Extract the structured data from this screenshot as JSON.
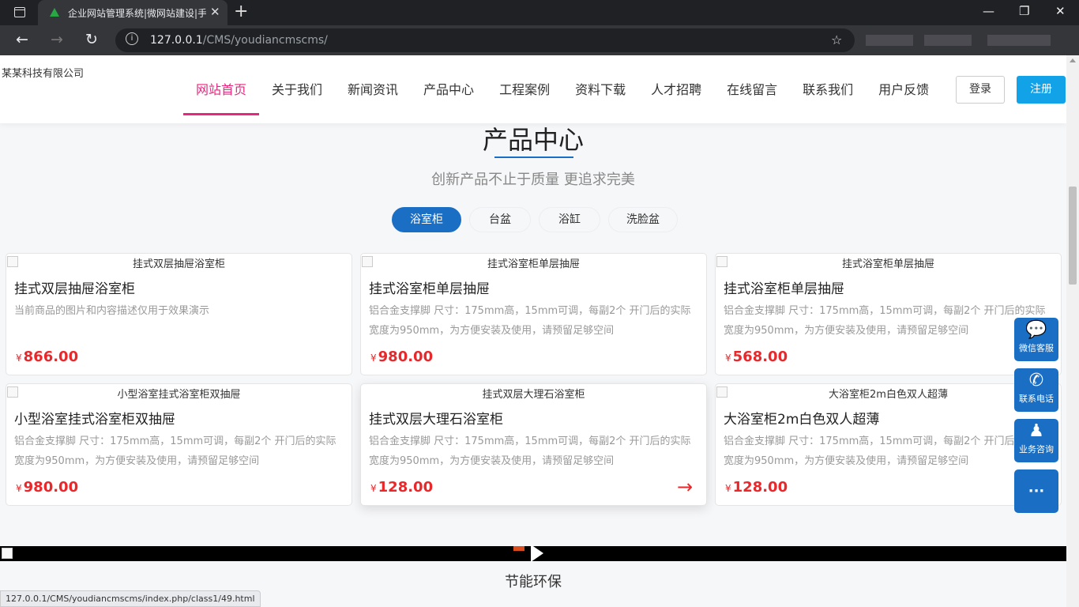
{
  "browser": {
    "tab_title": "企业网站管理系统|微网站建设|手",
    "url_host": "127.0.0.1",
    "url_path": "/CMS/youdiancmscms/",
    "status_url": "127.0.0.1/CMS/youdiancmscms/index.php/class1/49.html"
  },
  "header": {
    "logo_alt": "某某科技有限公司",
    "nav": [
      "网站首页",
      "关于我们",
      "新闻资讯",
      "产品中心",
      "工程案例",
      "资料下载",
      "人才招聘",
      "在线留言",
      "联系我们",
      "用户反馈"
    ],
    "login": "登录",
    "register": "注册"
  },
  "section": {
    "title": "产品中心",
    "subtitle": "创新产品不止于质量 更追求完美",
    "categories": [
      "浴室柜",
      "台盆",
      "浴缸",
      "洗脸盆"
    ]
  },
  "currency": "¥",
  "products": [
    {
      "name": "挂式双层抽屉浴室柜",
      "desc": "当前商品的图片和内容描述仅用于效果演示",
      "price": "866.00"
    },
    {
      "name": "挂式浴室柜单层抽屉",
      "desc": "铝合金支撑脚 尺寸：175mm高，15mm可调，每副2个 开门后的实际宽度为950mm，为方便安装及使用，请预留足够空间",
      "price": "980.00"
    },
    {
      "name": "挂式浴室柜单层抽屉",
      "desc": "铝合金支撑脚 尺寸：175mm高，15mm可调，每副2个 开门后的实际宽度为950mm，为方便安装及使用，请预留足够空间",
      "price": "568.00"
    },
    {
      "name": "小型浴室挂式浴室柜双抽屉",
      "desc": "铝合金支撑脚 尺寸：175mm高，15mm可调，每副2个 开门后的实际宽度为950mm，为方便安装及使用，请预留足够空间",
      "price": "980.00"
    },
    {
      "name": "挂式双层大理石浴室柜",
      "desc": "铝合金支撑脚 尺寸：175mm高，15mm可调，每副2个 开门后的实际宽度为950mm，为方便安装及使用，请预留足够空间",
      "price": "128.00"
    },
    {
      "name": "大浴室柜2m白色双人超薄",
      "desc": "铝合金支撑脚 尺寸：175mm高，15mm可调，每副2个 开门后的实际宽度为950mm，为方便安装及使用，请预留足够空间",
      "price": "128.00"
    }
  ],
  "float_bar": [
    {
      "label": "微信客服",
      "icon": "wechat-icon"
    },
    {
      "label": "联系电话",
      "icon": "phone-icon"
    },
    {
      "label": "业务咨询",
      "icon": "qq-icon"
    },
    {
      "label": "···",
      "icon": "more-icon"
    }
  ],
  "bottom_title": "节能环保",
  "colors": {
    "accent": "#1a6fc4",
    "nav_active": "#e6287e",
    "price": "#e8282b",
    "register": "#12a2e8"
  }
}
